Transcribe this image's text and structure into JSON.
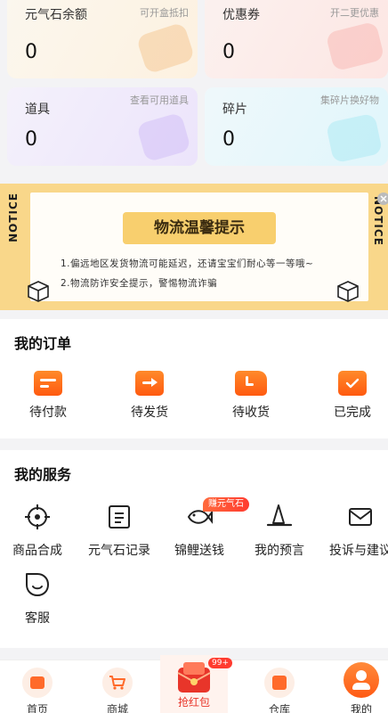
{
  "stats": {
    "cards": [
      {
        "title": "元气石余额",
        "value": "0",
        "hint": "可开盒抵扣"
      },
      {
        "title": "优惠券",
        "value": "0",
        "hint": "开二更优惠"
      },
      {
        "title": "道具",
        "value": "0",
        "hint": "查看可用道具"
      },
      {
        "title": "碎片",
        "value": "0",
        "hint": "集碎片换好物"
      }
    ]
  },
  "notice": {
    "strip_label": "NOTICE",
    "title": "物流温馨提示",
    "lines": [
      "1.偏远地区发货物流可能延迟，还请宝宝们耐心等一等哦~",
      "2.物流防诈安全提示，警惕物流诈骗"
    ]
  },
  "orders": {
    "title": "我的订单",
    "items": [
      {
        "label": "待付款",
        "icon": "wallet-icon"
      },
      {
        "label": "待发货",
        "icon": "box-arrow-icon"
      },
      {
        "label": "待收货",
        "icon": "truck-icon"
      },
      {
        "label": "已完成",
        "icon": "calendar-check-icon"
      }
    ]
  },
  "services": {
    "title": "我的服务",
    "badge": "赚元气石",
    "items": [
      {
        "label": "商品合成",
        "icon": "crosshair-icon"
      },
      {
        "label": "元气石记录",
        "icon": "list-icon"
      },
      {
        "label": "锦鲤送钱",
        "icon": "fish-icon"
      },
      {
        "label": "我的预言",
        "icon": "witch-hat-icon"
      },
      {
        "label": "投诉与建议",
        "icon": "mail-icon"
      },
      {
        "label": "客服",
        "icon": "chat-icon"
      }
    ]
  },
  "tabbar": {
    "badge": "99+",
    "items": [
      {
        "label": "首页",
        "icon": "home-icon"
      },
      {
        "label": "商城",
        "icon": "cart-icon"
      },
      {
        "label": "抢红包",
        "icon": "red-envelope-icon"
      },
      {
        "label": "仓库",
        "icon": "warehouse-icon"
      },
      {
        "label": "我的",
        "icon": "profile-icon"
      }
    ]
  },
  "colors": {
    "accent": "#ff5a14",
    "notice_bg": "#f9d78a",
    "notice_title_bg": "#f8cf6e"
  }
}
